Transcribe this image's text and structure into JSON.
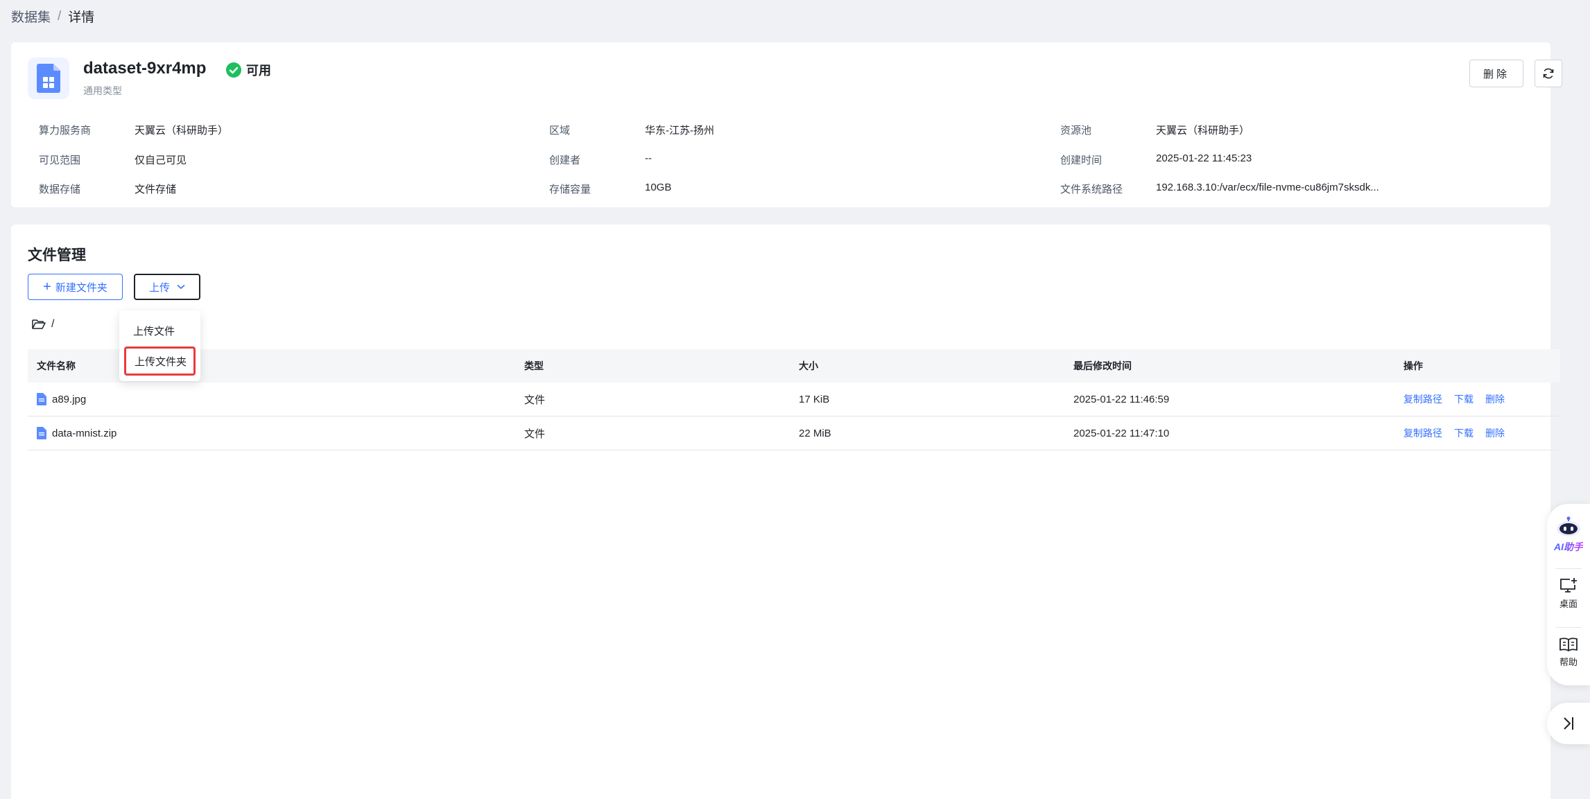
{
  "breadcrumb": {
    "parent": "数据集",
    "separator": "/",
    "current": "详情"
  },
  "dataset": {
    "name": "dataset-9xr4mp",
    "status": "可用",
    "type": "通用类型",
    "actions": {
      "delete_label": "删除"
    },
    "info": [
      {
        "key": "算力服务商",
        "value": "天翼云（科研助手）"
      },
      {
        "key": "区域",
        "value": "华东-江苏-扬州"
      },
      {
        "key": "资源池",
        "value": "天翼云（科研助手）"
      },
      {
        "key": "可见范围",
        "value": "仅自己可见"
      },
      {
        "key": "创建者",
        "value": "--"
      },
      {
        "key": "创建时间",
        "value": "2025-01-22 11:45:23"
      },
      {
        "key": "数据存储",
        "value": "文件存储"
      },
      {
        "key": "存储容量",
        "value": "10GB"
      },
      {
        "key": "文件系统路径",
        "value": "192.168.3.10:/var/ecx/file-nvme-cu86jm7sksdk..."
      }
    ]
  },
  "files": {
    "title": "文件管理",
    "new_folder_label": "新建文件夹",
    "upload_label": "上传",
    "path": "/",
    "upload_menu": [
      "上传文件",
      "上传文件夹"
    ],
    "columns": [
      "文件名称",
      "类型",
      "大小",
      "最后修改时间",
      "操作"
    ],
    "rows": [
      {
        "name": "a89.jpg",
        "type": "文件",
        "size": "17 KiB",
        "modified": "2025-01-22 11:46:59"
      },
      {
        "name": "data-mnist.zip",
        "type": "文件",
        "size": "22 MiB",
        "modified": "2025-01-22 11:47:10"
      }
    ],
    "row_actions": [
      "复制路径",
      "下载",
      "删除"
    ]
  },
  "float_panel": {
    "ai_label": "AI助手",
    "desktop_label": "桌面",
    "help_label": "帮助"
  },
  "colors": {
    "primary": "#3370ff",
    "status_green": "#1fbf5f",
    "highlight_red": "#e83b3b"
  }
}
